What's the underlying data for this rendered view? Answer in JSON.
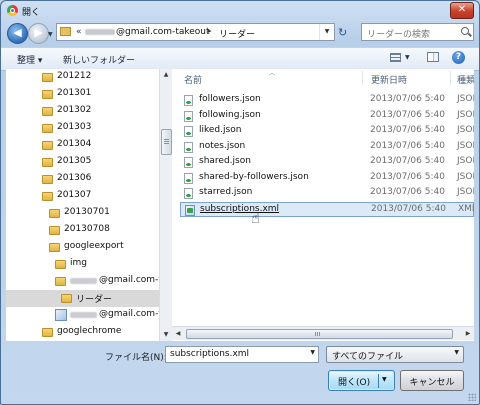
{
  "window": {
    "title": "開く",
    "close_glyph": "✕"
  },
  "nav": {
    "back_glyph": "◀",
    "fwd_glyph": "▶",
    "address_chevron": "«",
    "address_account": "@gmail.com-takeout",
    "address_separator": "▸",
    "address_folder": "リーダー",
    "refresh_glyph": "↻",
    "search_placeholder": "リーダーの検索"
  },
  "toolbar": {
    "organize": "整理 ▾",
    "new_folder": "新しいフォルダー",
    "help": "?"
  },
  "tree": [
    {
      "label": "201212",
      "indent": 1,
      "kind": "folder"
    },
    {
      "label": "201301",
      "indent": 1,
      "kind": "folder"
    },
    {
      "label": "201302",
      "indent": 1,
      "kind": "folder"
    },
    {
      "label": "201303",
      "indent": 1,
      "kind": "folder"
    },
    {
      "label": "201304",
      "indent": 1,
      "kind": "folder"
    },
    {
      "label": "201305",
      "indent": 1,
      "kind": "folder"
    },
    {
      "label": "201306",
      "indent": 1,
      "kind": "folder"
    },
    {
      "label": "201307",
      "indent": 1,
      "kind": "folder"
    },
    {
      "label": "20130701",
      "indent": 2,
      "kind": "folder"
    },
    {
      "label": "20130708",
      "indent": 2,
      "kind": "folder"
    },
    {
      "label": "googleexport",
      "indent": 2,
      "kind": "folder"
    },
    {
      "label": "img",
      "indent": 3,
      "kind": "folder"
    },
    {
      "label": "@gmail.com-ta",
      "indent": 3,
      "kind": "folder",
      "blurred_prefix": true
    },
    {
      "label": "リーダー",
      "indent": 4,
      "kind": "folder",
      "selected": true
    },
    {
      "label": "@gmail.com-ta",
      "indent": 3,
      "kind": "image",
      "blurred_prefix": true
    },
    {
      "label": "googlechrome",
      "indent": 1,
      "kind": "folder"
    }
  ],
  "columns": {
    "name": "名前",
    "date": "更新日時",
    "type": "種類"
  },
  "files": [
    {
      "name": "followers.json",
      "date": "2013/07/06 5:40",
      "type": "JSON",
      "kind": "json"
    },
    {
      "name": "following.json",
      "date": "2013/07/06 5:40",
      "type": "JSON",
      "kind": "json"
    },
    {
      "name": "liked.json",
      "date": "2013/07/06 5:40",
      "type": "JSON",
      "kind": "json"
    },
    {
      "name": "notes.json",
      "date": "2013/07/06 5:40",
      "type": "JSON",
      "kind": "json"
    },
    {
      "name": "shared.json",
      "date": "2013/07/06 5:40",
      "type": "JSON",
      "kind": "json"
    },
    {
      "name": "shared-by-followers.json",
      "date": "2013/07/06 5:40",
      "type": "JSON",
      "kind": "json"
    },
    {
      "name": "starred.json",
      "date": "2013/07/06 5:40",
      "type": "JSON",
      "kind": "json"
    },
    {
      "name": "subscriptions.xml",
      "date": "2013/07/06 5:40",
      "type": "XML",
      "kind": "xml",
      "hovered": true
    }
  ],
  "footer": {
    "filename_label": "ファイル名(N):",
    "filename_value": "subscriptions.xml",
    "filetype_value": "すべてのファイル",
    "open_label": "開く(O)",
    "cancel_label": "キャンセル"
  }
}
